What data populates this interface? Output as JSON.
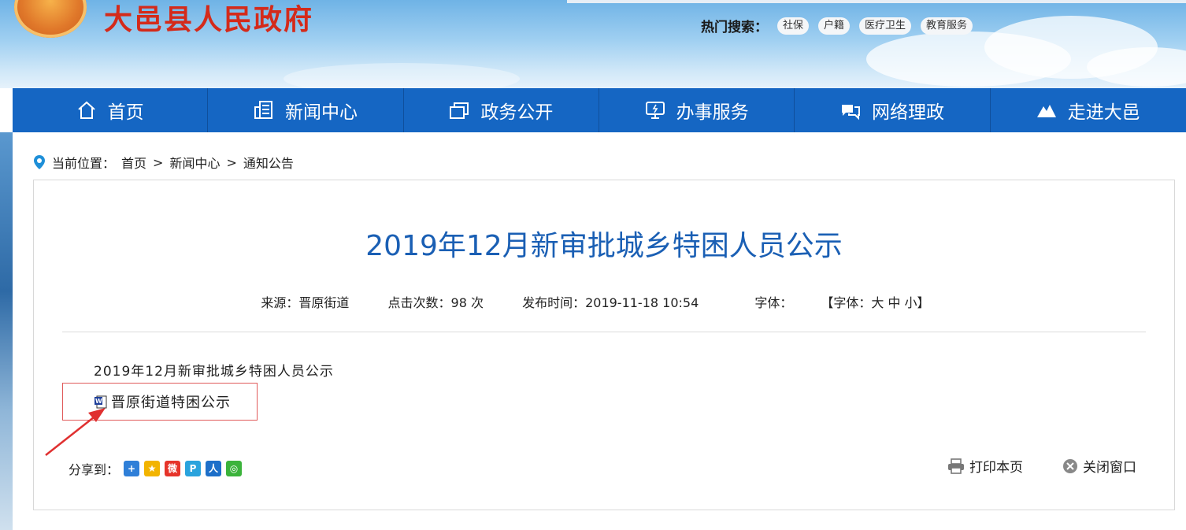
{
  "site": {
    "title": "大邑县人民政府"
  },
  "hot_search": {
    "label": "热门搜索：",
    "tags": [
      "社保",
      "户籍",
      "医疗卫生",
      "教育服务"
    ]
  },
  "nav": {
    "items": [
      {
        "label": "首页",
        "icon": "home-icon"
      },
      {
        "label": "新闻中心",
        "icon": "newspaper-icon"
      },
      {
        "label": "政务公开",
        "icon": "windows-icon"
      },
      {
        "label": "办事服务",
        "icon": "monitor-icon"
      },
      {
        "label": "网络理政",
        "icon": "chat-icon"
      },
      {
        "label": "走进大邑",
        "icon": "mountain-icon"
      }
    ]
  },
  "breadcrumb": {
    "prefix": "当前位置：",
    "items": [
      "首页",
      "新闻中心",
      "通知公告"
    ],
    "separator": ">"
  },
  "article": {
    "title": "2019年12月新审批城乡特困人员公示",
    "meta": {
      "source": "来源：晋原街道",
      "clicks": "点击次数：98 次",
      "published": "发布时间：2019-11-18 10:54",
      "font_label": "字体：",
      "font_options": "【字体：大 中 小】"
    },
    "body_text": "2019年12月新审批城乡特困人员公示",
    "attachment": {
      "label": "晋原街道特困公示",
      "icon": "word-doc-icon"
    }
  },
  "share": {
    "label": "分享到：",
    "buttons": [
      {
        "name": "share-more",
        "color": "#2f7fd8",
        "glyph": "+"
      },
      {
        "name": "share-qzone",
        "color": "#f2b400",
        "glyph": "★"
      },
      {
        "name": "share-weibo",
        "color": "#e6342a",
        "glyph": "微"
      },
      {
        "name": "share-tqq",
        "color": "#2aa3dd",
        "glyph": "P"
      },
      {
        "name": "share-renren",
        "color": "#1d6fc9",
        "glyph": "人"
      },
      {
        "name": "share-wechat",
        "color": "#3bb33b",
        "glyph": "◎"
      }
    ]
  },
  "actions": {
    "print": "打印本页",
    "close": "关闭窗口"
  },
  "colors": {
    "nav_bg": "#1566c3",
    "title_blue": "#1a5fb4",
    "logo_red": "#d42a1a",
    "highlight_red": "#e05a5a"
  }
}
